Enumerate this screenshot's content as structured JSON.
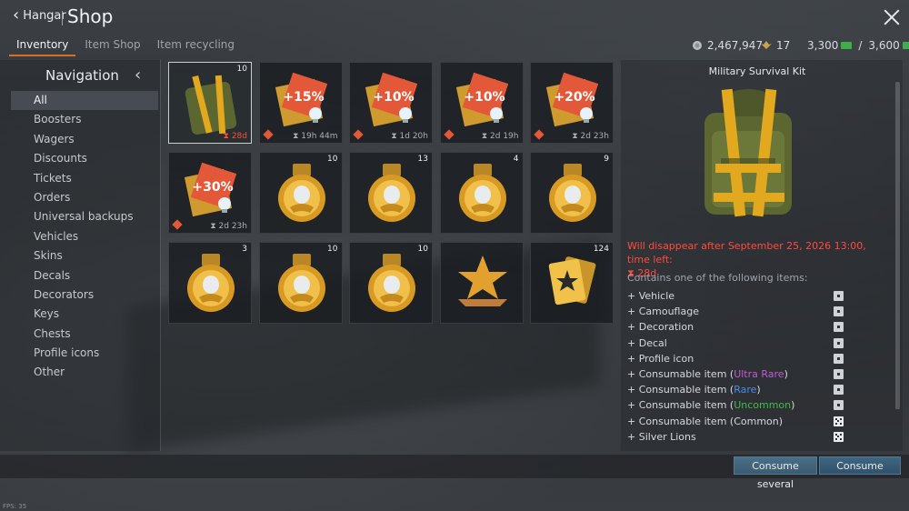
{
  "header": {
    "back_label": "Hangar",
    "title": "Shop"
  },
  "tabs": [
    {
      "label": "Inventory",
      "active": true
    },
    {
      "label": "Item Shop",
      "active": false
    },
    {
      "label": "Item recycling",
      "active": false
    }
  ],
  "currency": {
    "silver_lions": "2,467,947",
    "eagles": "17",
    "golden_eagles": "3,300",
    "golden_eagles_max": "3,600",
    "separator": "/"
  },
  "navigation": {
    "title": "Navigation",
    "items": [
      "All",
      "Boosters",
      "Wagers",
      "Discounts",
      "Tickets",
      "Orders",
      "Universal backups",
      "Vehicles",
      "Skins",
      "Decals",
      "Decorators",
      "Keys",
      "Chests",
      "Profile icons",
      "Other"
    ],
    "active_index": 0
  },
  "inventory": [
    {
      "icon": "backpack-icon",
      "count": "10",
      "timer": "28d",
      "timer_red": true
    },
    {
      "icon": "booster-15-icon",
      "badge": "+15%",
      "count": "",
      "timer": "19h 44m"
    },
    {
      "icon": "booster-10-icon",
      "badge": "+10%",
      "count": "",
      "timer": "1d 20h"
    },
    {
      "icon": "booster-10-arrows-icon",
      "badge": "+10%",
      "count": "",
      "timer": "2d 19h"
    },
    {
      "icon": "booster-20-icon",
      "badge": "+20%",
      "count": "",
      "timer": "2d 23h"
    },
    {
      "icon": "booster-30-icon",
      "badge": "+30%",
      "count": "",
      "timer": "2d 23h"
    },
    {
      "icon": "wager-medal-icon",
      "count": "10",
      "timer": ""
    },
    {
      "icon": "wager-medal-icon",
      "count": "13",
      "timer": ""
    },
    {
      "icon": "wager-medal-10-icon",
      "count": "4",
      "timer": ""
    },
    {
      "icon": "wager-medal-icon",
      "count": "9",
      "timer": ""
    },
    {
      "icon": "wager-medal-star-icon",
      "count": "3",
      "timer": ""
    },
    {
      "icon": "wager-medal-icon",
      "count": "10",
      "timer": ""
    },
    {
      "icon": "wager-medal-icon",
      "count": "10",
      "timer": ""
    },
    {
      "icon": "star-trophy-icon",
      "count": "",
      "timer": ""
    },
    {
      "icon": "star-cards-icon",
      "count": "124",
      "timer": ""
    }
  ],
  "detail": {
    "title": "Military Survival Kit",
    "warning": "Will disappear after September 25, 2026 13:00, time left:",
    "time_left": "28d",
    "contains_label": "Contains one of the following items:",
    "items": [
      {
        "label": "Vehicle",
        "box": "square"
      },
      {
        "label": "Camouflage",
        "box": "square"
      },
      {
        "label": "Decoration",
        "box": "square"
      },
      {
        "label": "Decal",
        "box": "square"
      },
      {
        "label": "Profile icon",
        "box": "square"
      },
      {
        "label": "Consumable item (",
        "tier": "Ultra Rare",
        "tier_class": "ultra",
        "suffix": ")",
        "box": "square"
      },
      {
        "label": "Consumable item (",
        "tier": "Rare",
        "tier_class": "rare",
        "suffix": ")",
        "box": "square"
      },
      {
        "label": "Consumable item (",
        "tier": "Uncommon",
        "tier_class": "uncommon",
        "suffix": ")",
        "box": "square"
      },
      {
        "label": "Consumable item (Common)",
        "box": "dice"
      },
      {
        "label": "Silver Lions",
        "box": "dice"
      }
    ]
  },
  "buttons": {
    "consume_several": "Consume several",
    "consume": "Consume"
  },
  "fps": "FPS: 35",
  "colors": {
    "accent_orange": "#d4702a",
    "warning_red": "#ff4b3d",
    "button_blue": "#3f6680"
  }
}
